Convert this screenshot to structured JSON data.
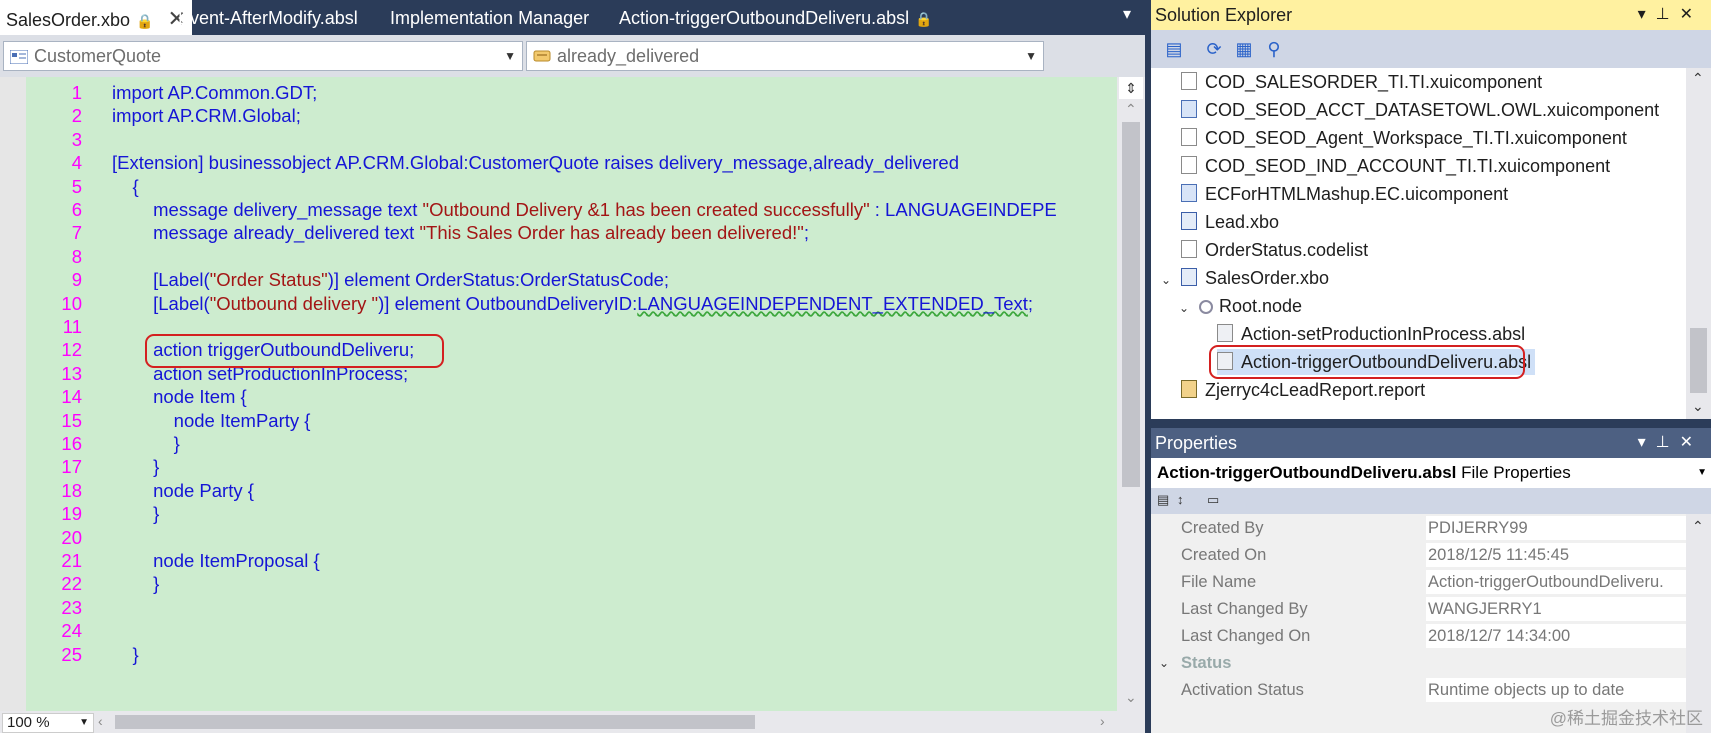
{
  "tabs": [
    {
      "label": "SalesOrder.xbo",
      "active": true,
      "locked": true,
      "closable": true
    },
    {
      "label": "Event-AfterModify.absl"
    },
    {
      "label": "Implementation Manager"
    },
    {
      "label": "Action-triggerOutboundDeliveru.absl",
      "locked": true
    }
  ],
  "navbar": {
    "left_dropdown": "CustomerQuote",
    "right_dropdown": "already_delivered"
  },
  "code_lines": [
    {
      "n": "1",
      "text": "import AP.Common.GDT;"
    },
    {
      "n": "2",
      "text": "import AP.CRM.Global;"
    },
    {
      "n": "3",
      "text": ""
    },
    {
      "n": "4",
      "text": "[Extension] businessobject AP.CRM.Global:CustomerQuote raises delivery_message,already_delivered"
    },
    {
      "n": "5",
      "text": "    {"
    },
    {
      "n": "6",
      "pre": "        message delivery_message text ",
      "str": "\"Outbound Delivery &1 has been created successfully\"",
      "post": " : LANGUAGEINDEPE"
    },
    {
      "n": "7",
      "pre": "        message already_delivered text ",
      "str": "\"This Sales Order has already been delivered!\"",
      "post": ";"
    },
    {
      "n": "8",
      "text": ""
    },
    {
      "n": "9",
      "pre": "        [Label(",
      "str": "\"Order Status\"",
      "post": ")] element OrderStatus:OrderStatusCode;"
    },
    {
      "n": "10",
      "pre": "        [Label(",
      "str": "\"Outbound delivery \"",
      "post": ")] element OutboundDeliveryID:",
      "squig": "LANGUAGEINDEPENDENT_EXTENDED_Text",
      "post2": ";"
    },
    {
      "n": "11",
      "text": ""
    },
    {
      "n": "12",
      "text": "        action triggerOutboundDeliveru;"
    },
    {
      "n": "13",
      "text": "        action setProductionInProcess;"
    },
    {
      "n": "14",
      "text": "        node Item {"
    },
    {
      "n": "15",
      "text": "            node ItemParty {"
    },
    {
      "n": "16",
      "text": "            }"
    },
    {
      "n": "17",
      "text": "        }"
    },
    {
      "n": "18",
      "text": "        node Party {"
    },
    {
      "n": "19",
      "text": "        }"
    },
    {
      "n": "20",
      "text": ""
    },
    {
      "n": "21",
      "text": "        node ItemProposal {"
    },
    {
      "n": "22",
      "text": "        }"
    },
    {
      "n": "23",
      "text": ""
    },
    {
      "n": "24",
      "text": ""
    },
    {
      "n": "25",
      "text": "    }"
    }
  ],
  "zoom": "100 %",
  "solution_explorer": {
    "title": "Solution Explorer",
    "items": [
      {
        "label": "COD_SALESORDER_TI.TI.xuicomponent",
        "indent": 0,
        "icon": "file"
      },
      {
        "label": "COD_SEOD_ACCT_DATASETOWL.OWL.xuicomponent",
        "indent": 0,
        "icon": "component"
      },
      {
        "label": "COD_SEOD_Agent_Workspace_TI.TI.xuicomponent",
        "indent": 0,
        "icon": "file"
      },
      {
        "label": "COD_SEOD_IND_ACCOUNT_TI.TI.xuicomponent",
        "indent": 0,
        "icon": "file"
      },
      {
        "label": "ECForHTMLMashup.EC.uicomponent",
        "indent": 0,
        "icon": "component"
      },
      {
        "label": "Lead.xbo",
        "indent": 0,
        "icon": "xbo"
      },
      {
        "label": "OrderStatus.codelist",
        "indent": 0,
        "icon": "file"
      },
      {
        "label": "SalesOrder.xbo",
        "indent": 0,
        "icon": "xbo",
        "expanded": true
      },
      {
        "label": "Root.node",
        "indent": 1,
        "icon": "node",
        "expanded": true
      },
      {
        "label": "Action-setProductionInProcess.absl",
        "indent": 2,
        "icon": "absl"
      },
      {
        "label": "Action-triggerOutboundDeliveru.absl",
        "indent": 2,
        "icon": "absl",
        "selected": true
      },
      {
        "label": "Zjerryc4cLeadReport.report",
        "indent": 0,
        "icon": "report"
      }
    ]
  },
  "properties": {
    "title": "Properties",
    "header_name": "Action-triggerOutboundDeliveru.absl",
    "header_suffix": "File Properties",
    "rows": [
      {
        "key": "Created By",
        "value": "PDIJERRY99"
      },
      {
        "key": "Created On",
        "value": "2018/12/5 11:45:45"
      },
      {
        "key": "File Name",
        "value": "Action-triggerOutboundDeliveru."
      },
      {
        "key": "Last Changed By",
        "value": "WANGJERRY1"
      },
      {
        "key": "Last Changed On",
        "value": "2018/12/7 14:34:00"
      },
      {
        "category": "Status"
      },
      {
        "key": "Activation Status",
        "value": "Runtime objects up to date"
      }
    ]
  },
  "watermark": "@稀土掘金技术社区",
  "colors": {
    "code_bg": "#cdeccf",
    "line_numbers": "#ff00ff",
    "keyword": "#1515d6",
    "string": "#a31515",
    "highlight": "#d42020"
  }
}
